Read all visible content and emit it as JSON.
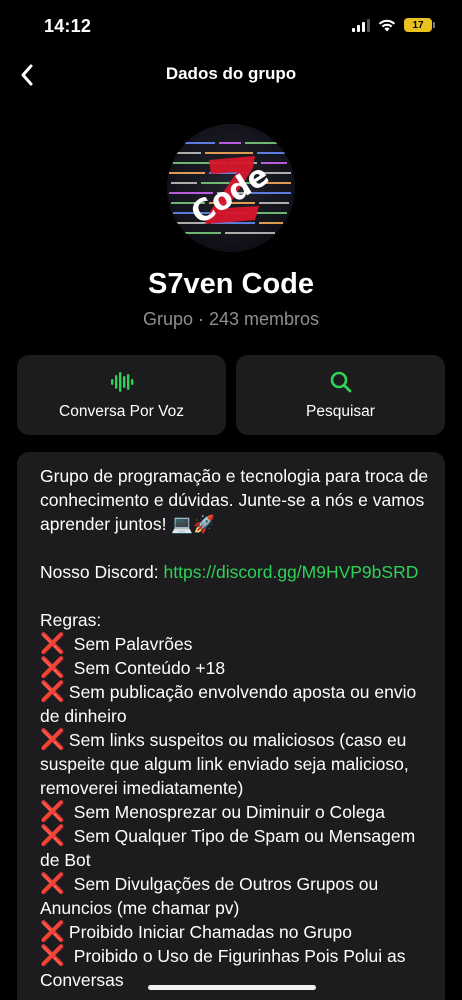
{
  "status_bar": {
    "time": "14:12",
    "battery": "17"
  },
  "nav": {
    "title": "Dados do grupo",
    "back_icon": "chevron-left-icon"
  },
  "group": {
    "name": "S7ven Code",
    "subtitle": "Grupo · 243 membros",
    "avatar_text": "Code"
  },
  "actions": [
    {
      "label": "Conversa Por Voz",
      "icon": "voice-waveform-icon"
    },
    {
      "label": "Pesquisar",
      "icon": "search-icon"
    }
  ],
  "description": {
    "intro": "Grupo de programação e tecnologia para troca de conhecimento e dúvidas. Junte-se a nós e vamos aprender juntos! 💻🚀",
    "discord_label": "Nosso Discord: ",
    "discord_link": "https://discord.gg/M9HVP9bSRD",
    "rules_title": "Regras:",
    "rules": [
      " Sem Palavrões",
      " Sem Conteúdo +18",
      "Sem publicação envolvendo aposta ou envio de dinheiro",
      "Sem links suspeitos ou maliciosos (caso eu suspeite que algum link enviado seja malicioso, removerei imediatamente)",
      " Sem Menosprezar ou Diminuir o Colega",
      " Sem Qualquer Tipo de Spam ou Mensagem de Bot",
      " Sem Divulgações de Outros Grupos ou Anuncios (me chamar pv)",
      "Proibido Iniciar Chamadas no Grupo",
      " Proibido o Uso de Figurinhas Pois Polui as Conversas"
    ],
    "rule_marker": "❌"
  },
  "colors": {
    "accent": "#2fd158",
    "card": "#1c1c1e",
    "muted": "#8e8e93",
    "rule_x": "#e02424"
  }
}
